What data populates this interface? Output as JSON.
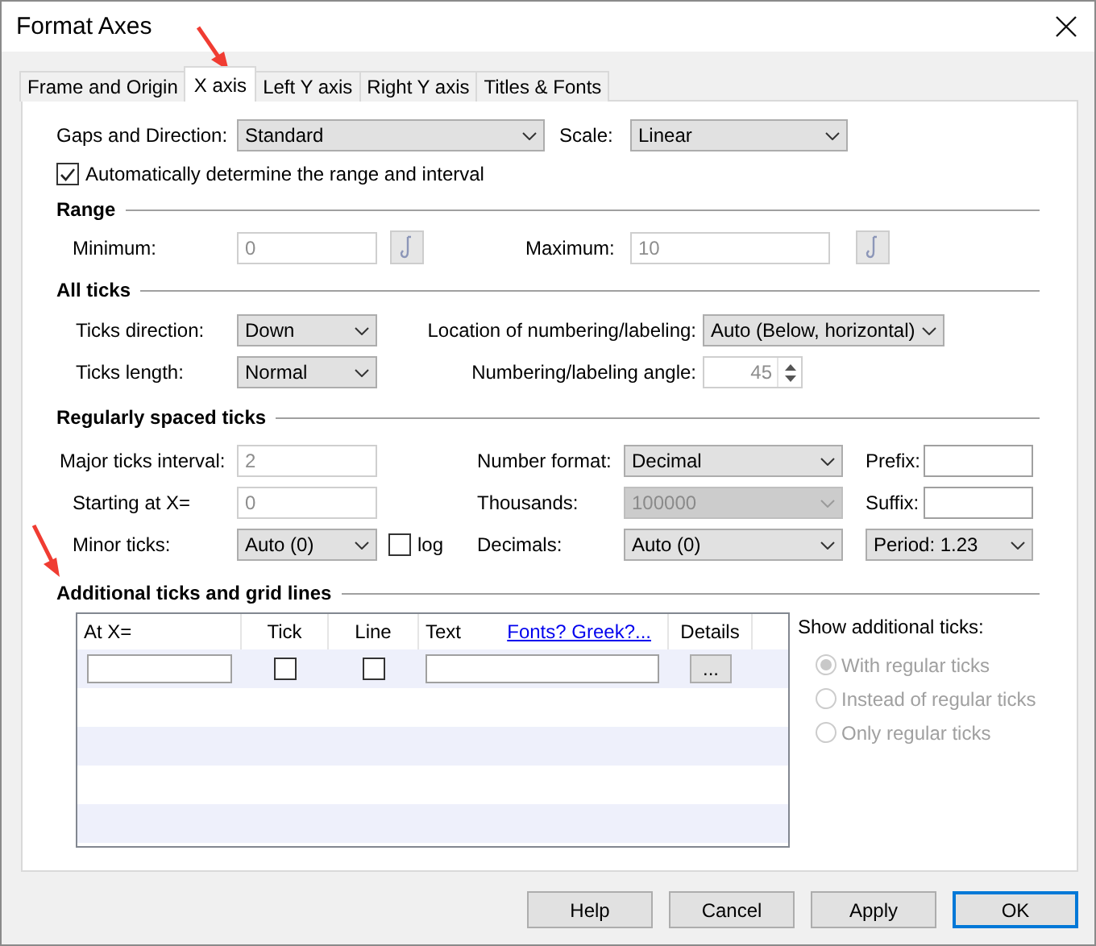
{
  "window": {
    "title": "Format Axes"
  },
  "tabs": [
    {
      "label": "Frame and Origin",
      "selected": false
    },
    {
      "label": "X axis",
      "selected": true
    },
    {
      "label": "Left Y axis",
      "selected": false
    },
    {
      "label": "Right Y axis",
      "selected": false
    },
    {
      "label": "Titles & Fonts",
      "selected": false
    }
  ],
  "gaps_and_direction": {
    "label": "Gaps and Direction:",
    "value": "Standard"
  },
  "scale": {
    "label": "Scale:",
    "value": "Linear"
  },
  "auto_range": {
    "label": "Automatically determine the range and interval",
    "checked": true
  },
  "range": {
    "title": "Range",
    "minimum": {
      "label": "Minimum:",
      "value": "0",
      "disabled": true
    },
    "maximum": {
      "label": "Maximum:",
      "value": "10",
      "disabled": true
    }
  },
  "all_ticks": {
    "title": "All ticks",
    "direction": {
      "label": "Ticks direction:",
      "value": "Down"
    },
    "length": {
      "label": "Ticks length:",
      "value": "Normal"
    },
    "location": {
      "label": "Location of numbering/labeling:",
      "value": "Auto (Below, horizontal)"
    },
    "angle": {
      "label": "Numbering/labeling angle:",
      "value": "45",
      "disabled": true
    }
  },
  "regular_ticks": {
    "title": "Regularly spaced ticks",
    "major_interval": {
      "label": "Major ticks interval:",
      "value": "2",
      "disabled": true
    },
    "starting_at": {
      "label": "Starting at X=",
      "value": "0",
      "disabled": true
    },
    "minor_ticks": {
      "label": "Minor ticks:",
      "value": "Auto (0)"
    },
    "log": {
      "label": "log",
      "checked": false
    },
    "number_format": {
      "label": "Number format:",
      "value": "Decimal"
    },
    "thousands": {
      "label": "Thousands:",
      "value": "100000",
      "disabled": true
    },
    "decimals": {
      "label": "Decimals:",
      "value": "Auto (0)"
    },
    "prefix": {
      "label": "Prefix:"
    },
    "suffix": {
      "label": "Suffix:"
    },
    "period": {
      "value": "Period: 1.23"
    }
  },
  "additional": {
    "title": "Additional ticks and grid lines",
    "columns": [
      {
        "label": "At X="
      },
      {
        "label": "Tick"
      },
      {
        "label": "Line"
      },
      {
        "label": "Text",
        "link": "Fonts? Greek?..."
      },
      {
        "label": "Details"
      }
    ],
    "rows": [
      {
        "tick": false,
        "line": false,
        "details": "..."
      }
    ],
    "show": {
      "label": "Show additional ticks:",
      "options": [
        {
          "label": "With regular ticks",
          "selected": true,
          "disabled": true
        },
        {
          "label": "Instead of regular ticks",
          "selected": false,
          "disabled": true
        },
        {
          "label": "Only regular ticks",
          "selected": false,
          "disabled": true
        }
      ]
    }
  },
  "buttons": [
    {
      "label": "Help",
      "default": false
    },
    {
      "label": "Cancel",
      "default": false
    },
    {
      "label": "Apply",
      "default": false
    },
    {
      "label": "OK",
      "default": true
    }
  ]
}
